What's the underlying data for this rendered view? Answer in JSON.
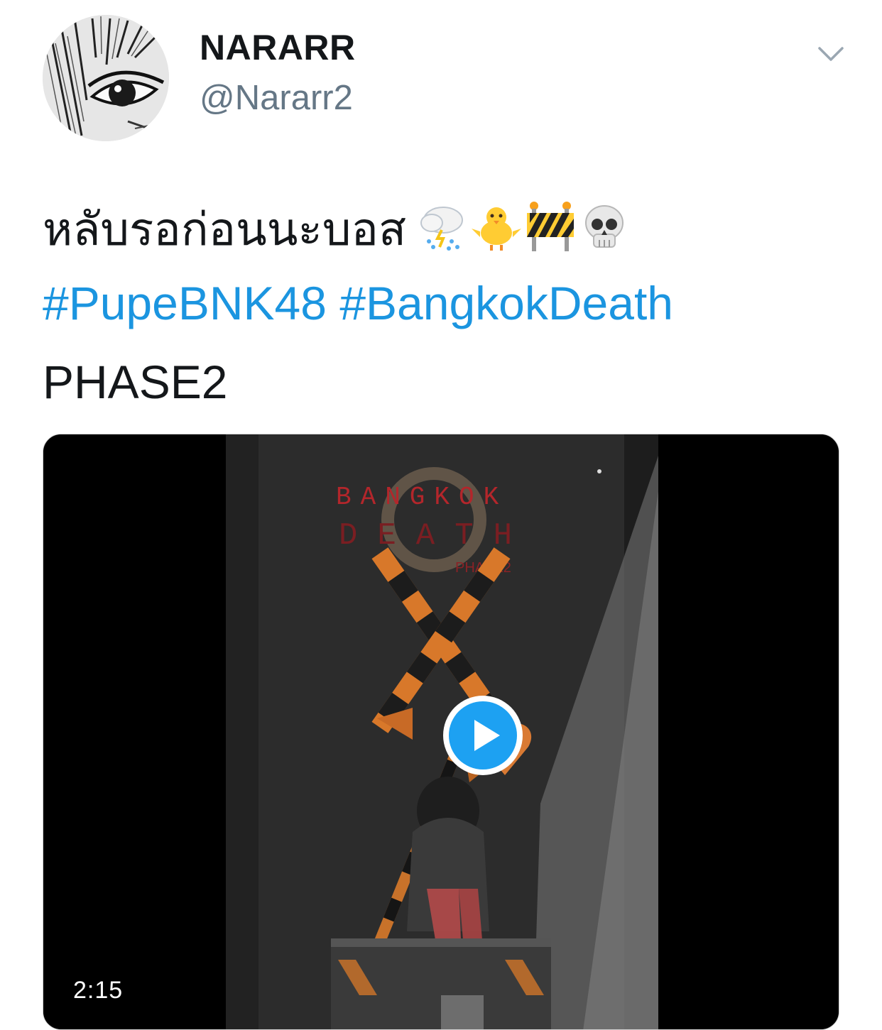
{
  "tweet": {
    "display_name": "NARARR",
    "handle": "@Nararr2",
    "text_thai": "หลับรอก่อนนะบอส",
    "emojis": [
      "cloud-with-lightning-and-rain-icon",
      "baby-chick-icon",
      "construction-barrier-icon",
      "skull-icon"
    ],
    "hashtags": [
      "#PupeBNK48",
      "#BangkokDeath"
    ],
    "text_line3": "PHASE2"
  },
  "media": {
    "poster_title_line1": "BANGKOK",
    "poster_title_line2": "DEATH",
    "poster_subtitle": "PHASE2",
    "duration": "2:15"
  },
  "colors": {
    "link": "#1b95e0",
    "secondary_text": "#657786",
    "play_button": "#1da1f2"
  }
}
